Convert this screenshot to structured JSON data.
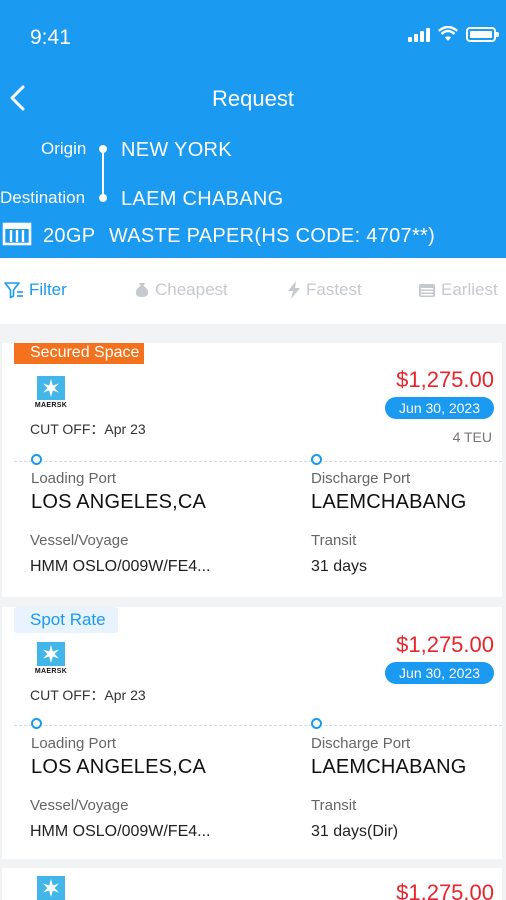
{
  "status_bar": {
    "time": "9:41"
  },
  "header": {
    "title": "Request",
    "origin_label": "Origin",
    "origin_value": "NEW YORK",
    "destination_label": "Destination",
    "destination_value": "LAEM CHABANG",
    "container_type": "20GP",
    "cargo_description": "WASTE PAPER(HS CODE: 4707**)"
  },
  "filters": {
    "filter": "Filter",
    "cheapest": "Cheapest",
    "fastest": "Fastest",
    "earliest": "Earliest"
  },
  "cards": [
    {
      "tag": "Secured Space",
      "carrier": "MAERSK",
      "cutoff": "CUT OFF：Apr 23",
      "price": "$1,275.00",
      "date": "Jun 30, 2023",
      "teu": "4 TEU",
      "loading_port_label": "Loading Port",
      "loading_port": "LOS ANGELES,CA",
      "discharge_port_label": "Discharge Port",
      "discharge_port": "LAEMCHABANG",
      "vessel_label": "Vessel/Voyage",
      "vessel": "HMM OSLO/009W/FE4...",
      "transit_label": "Transit",
      "transit": "31 days"
    },
    {
      "tag": "Spot Rate",
      "carrier": "MAERSK",
      "cutoff": "CUT OFF：Apr 23",
      "price": "$1,275.00",
      "date": "Jun 30, 2023",
      "loading_port_label": "Loading Port",
      "loading_port": "LOS ANGELES,CA",
      "discharge_port_label": "Discharge Port",
      "discharge_port": "LAEMCHABANG",
      "vessel_label": "Vessel/Voyage",
      "vessel": "HMM OSLO/009W/FE4...",
      "transit_label": "Transit",
      "transit": "31 days(Dir)"
    },
    {
      "price": "$1,275.00"
    }
  ],
  "colors": {
    "brand": "#1a9af0",
    "price": "#e8252d",
    "secured_tag": "#f4721d",
    "logo": "#42b6e8"
  },
  "icons": [
    "back-arrow-icon",
    "signal-icon",
    "wifi-icon",
    "battery-icon",
    "container-icon",
    "filter-icon",
    "cheapest-icon",
    "lightning-icon",
    "calendar-icon",
    "maersk-star-icon"
  ]
}
